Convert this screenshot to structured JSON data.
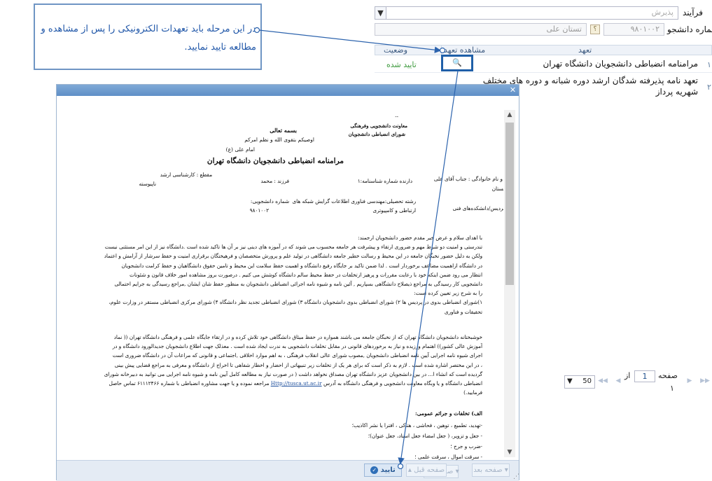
{
  "form": {
    "process_label": "فرآیند",
    "process_value": "پذیرش",
    "student_no_label": "شماره دانشجو",
    "student_no_value": "۹۸۰۱۰۰۲",
    "student_name_value": "تستان علی",
    "lookup_btn": "؟"
  },
  "grid": {
    "col_commitment": "تعهد",
    "col_view": "مشاهده تعهد",
    "col_status": "وضعیت",
    "rows": [
      {
        "num": "۱",
        "title": "مرامنامه انضباطی دانشجویان دانشگاه تهران",
        "status": "تایید شده"
      },
      {
        "num": "۲",
        "title": "تعهد نامه پذیرفته شدگان ارشد دوره شبانه و دوره های مختلف",
        "title2": "شهریه پرداز",
        "status": ""
      }
    ]
  },
  "pager": {
    "page_label": "صفحه",
    "page_value": "1",
    "of_label": "از",
    "total_pages": "۱",
    "page_size": "50"
  },
  "callout": {
    "line1": "در این مرحله باید تعهدات الکترونیکی را پس از مشاهده و",
    "line2": "مطالعه تایید نمایید."
  },
  "doc": {
    "dash": "--",
    "org1": "معاونت دانشجویی وفرهنگی",
    "org2": "شورای انضباطی دانشجویان",
    "bismillah": "بسمه تعالی",
    "verse": "اوصیکم بتقوی الله و نظم امرکم",
    "imam": "امام علی (ع)",
    "title": "مرامنامه انضباطی دانشجویان دانشگاه تهران",
    "name_line": "نام و نام خانوادگی : جناب آقای علی",
    "name_line2": "تستان",
    "id_card": "دارنده شماره شناسنامه:۱",
    "father": "فرزند : محمد",
    "degree": "مقطع : کارشناسی ارشد",
    "degree2": "ناپیوسته",
    "campus": "پردیس/دانشکده‌های فنی",
    "major": "رشته تحصیلی:مهندسی فناوری اطلاعات گرایش شبکه های",
    "major2": "ارتباطی و کامپیوتری",
    "student_no_label": "شماره دانشجویی:",
    "student_no": "۹۸۰۱۰۰۲",
    "para1": [
      "با اهدای سلام و عرض خیر مقدم حضور دانشجویان ارجمند:",
      "تندرستی و امنیت دو شرط مهم و ضروری ارتقاء و پیشرفت هر جامعه محسوب می شوند که در آموزه های دینی نیز بر آن ها تاکید شده است .دانشگاه نیز از این امر مستثنی نیست",
      "ولکن به دلیل حضور نخبگان جامعه در این محیط و رسالت خطیر جامعه دانشگاهی در تولید علم و پرورش متخصصان و فرهیختگان برقراری امنیت و حفظ سرشار از آرامش و اعتماد",
      "در دانشگاه ازاهمیت مضاعف برخوردار است . لذا ضمن تاکید بر جایگاه رفیع دانشگاه و اهمیت حفظ سلامت این محیط و تامین حقوق دانشگاهیان و حفظ کرامت دانشجویان",
      "انتظار می رود ضمن اینکه خود با رعایت مقررات و پرهیز ازتخلفات در حفظ محیط سالم دانشگاه کوشش می کنیم . درصورت بروز مشاهده امور خلاف قانون و شئونات",
      "دانشجویی کار رسیدگی به مراجع ذیصلاح دانشگاهی بسپاریم , آئین نامه و شیوه نامه اجرائی انضباطی دانشجویان به منظور حفظ شان ایشان ,مراجع رسیدگی به جرایم احتمالی",
      "را به شرح زیر تعیین کرده است:",
      "۱)شورای انضباطی بدوی در پردیس ها ۲) شورای انضباطی بدوی دانشجویان دانشگاه ۳) شورای انضباطی تجدید نظر دانشگاه ۴) شورای مرکزی انضباطی مستقر در وزارت علوم،",
      "تحقیقات و فناوری"
    ],
    "para2": [
      "خوشبختانه دانشجویان دانشگاه تهران که از نخبگان جامعه می باشند همواره در حفظ میثاق دانشگاهی خود تلاش کرده و در ارتقاء جایگاه علمی و فرهنگی دانشگاه تهران (( نماد",
      "آموزش عالی کشور)) اهتمام ورزیده و نیاز به برخوردهای قانونی در مقابل تخلفات دانشجویی به ندرت ایجاد شده است . معذلک جهت اطلاع دانشجویان جدیدالورود دانشگاه و در",
      "اجرای شیوه نامه اجرایی آیین نامه انضباطی دانشجویان ,مصوب شورای عالی انقلاب فرهنگی ، به اهم موارد اخلاقی ,اجتماعی و قانونی که مراعات آن در دانشگاه ضروری است",
      "، در این مختصر اشاره شده است . لازم به ذکر است که برای هر یک از تخلفات زیر تنبیهاتی از احضار و اخطار شفاهی تا اخراج از دانشگاه و معرفی به مراجع قضایی پیش بینی",
      "گردیده است که انشاء ا... در بین دانشجویان عزیز دانشگاه تهران مصداق نخواهد داشت ( در صورت نیاز به مطالعه کامل آیین نامه و شیوه نامه اجرایی می توانید به دبیرخانه شورای"
    ],
    "para2_last_pre": "انضباطی دانشگاه و یا وبگاه معاونت دانشجویی و فرهنگی دانشگاه به آدرس",
    "link": "Http://tusca.ut.ac.ir",
    "para2_last_post": "مراجعه نموده و یا جهت مشاوره انضباطی با شماره ۶۱۱۱۲۴۶۶ تماس حاصل",
    "para2_end": "فرمایید.)",
    "section_a": "الف) تخلفات و جرائم عمومی:",
    "items": [
      "-تهدید، تطمیع ، توهین ، فحاشی ، هتاکی ، افترا یا نشر اکاذیب؛",
      "- جعل و تزویر، ( جعل امضاء جعل اسناد، جعل عنوان)؛",
      "-ضرب و جرح ؛",
      "- سرقت اموال ، سرقت علمی ؛"
    ]
  },
  "footer": {
    "next_page": "صفحه بعد",
    "prev_page": "صفحه قبل",
    "confirm": "تایید"
  }
}
